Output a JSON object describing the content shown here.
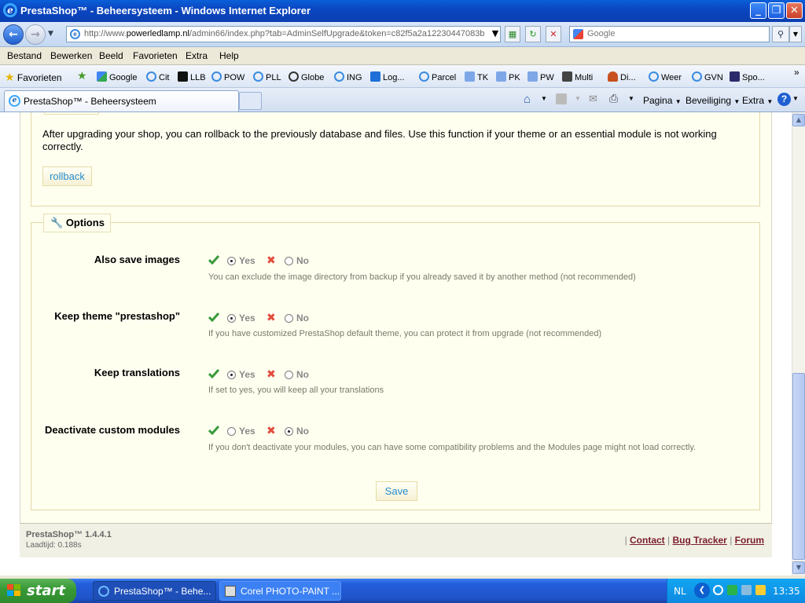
{
  "window": {
    "title": "PrestaShop™ - Beheersysteem - Windows Internet Explorer",
    "minimize": "_",
    "maximize": "❐",
    "close": "✕"
  },
  "address": {
    "url_prefix": "http://www.",
    "url_domain": "powerledlamp.nl",
    "url_rest": "/admin66/index.php?tab=AdminSelfUpgrade&token=c82f5a2a12230447083b",
    "search_placeholder": "Google"
  },
  "menubar": [
    "Bestand",
    "Bewerken",
    "Beeld",
    "Favorieten",
    "Extra",
    "Help"
  ],
  "favorites": {
    "label": "Favorieten",
    "items": [
      "Google",
      "Cit",
      "LLB",
      "POW",
      "PLL",
      "Globe",
      "ING",
      "Log...",
      "Parcel",
      "TK",
      "PK",
      "PW",
      "Multi",
      "Di...",
      "Weer",
      "GVN",
      "Spo..."
    ]
  },
  "tab": {
    "title": "PrestaShop™ - Beheersysteem"
  },
  "commandbar": {
    "page": "Pagina",
    "security": "Beveiliging",
    "extra": "Extra"
  },
  "content": {
    "rollback_text": "After upgrading your shop, you can rollback to the previously database and files. Use this function if your theme or an essential module is not working correctly.",
    "rollback_button": "rollback",
    "options_legend": "Options",
    "options": [
      {
        "label": "Also save images",
        "value": "Yes",
        "yes": "Yes",
        "no": "No",
        "hint": "You can exclude the image directory from backup if you already saved it by another method (not recommended)"
      },
      {
        "label": "Keep theme \"prestashop\"",
        "value": "Yes",
        "yes": "Yes",
        "no": "No",
        "hint": "If you have customized PrestaShop default theme, you can protect it from upgrade (not recommended)"
      },
      {
        "label": "Keep translations",
        "value": "Yes",
        "yes": "Yes",
        "no": "No",
        "hint": "If set to yes, you will keep all your translations"
      },
      {
        "label": "Deactivate custom modules",
        "value": "No",
        "yes": "Yes",
        "no": "No",
        "hint": "If you don't deactivate your modules, you can have some compatibility problems and the Modules page might not load correctly."
      }
    ],
    "save_button": "Save"
  },
  "footer": {
    "version": "PrestaShop™ 1.4.4.1",
    "loadtime": "Laadtijd: 0.188s",
    "contact": "Contact",
    "bugtracker": "Bug Tracker",
    "forum": "Forum"
  },
  "taskbar": {
    "start": "start",
    "tasks": [
      "PrestaShop™ - Behe...",
      "Corel PHOTO-PAINT ..."
    ],
    "language": "NL",
    "clock": "13:35"
  },
  "colors": {
    "accent_link": "#268ccd",
    "panel_bg": "#fffff0",
    "check_green": "#3a9b3a",
    "cross_red": "#e34c3c"
  }
}
